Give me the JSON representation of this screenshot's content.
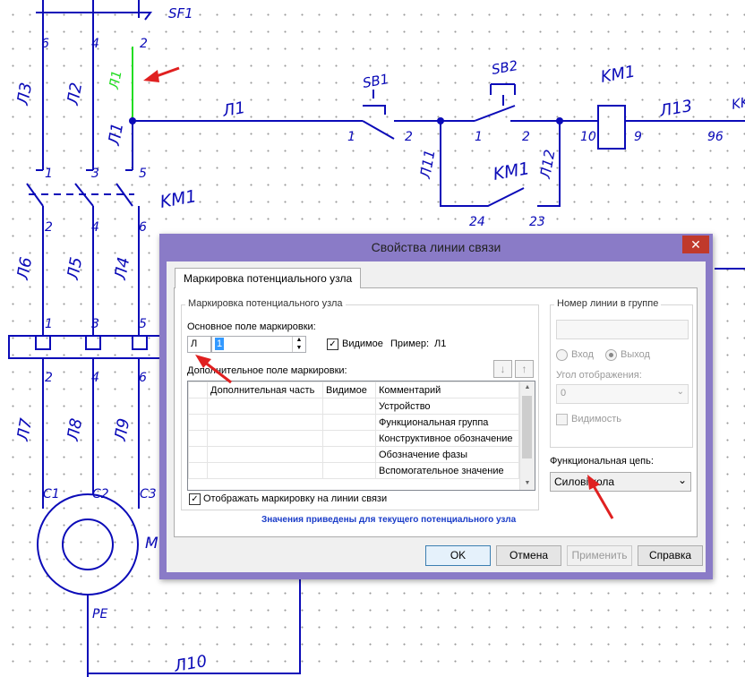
{
  "schematic": {
    "labels": {
      "sf1": "SF1",
      "sb1": "SB1",
      "sb2": "SB2",
      "km1_top": "KM1",
      "km1_mid": "KM1",
      "km1_contact": "KM1",
      "kk": "KK",
      "l3": "Л3",
      "l2": "Л2",
      "l1_green": "Л1",
      "l1_vert": "Л1",
      "l1_wire": "Л1",
      "l11": "Л11",
      "l12": "Л12",
      "l13": "Л13",
      "l6": "Л6",
      "l5": "Л5",
      "l4": "Л4",
      "l7": "Л7",
      "l8": "Л8",
      "l9": "Л9",
      "l10": "Л10",
      "n6_top": "6",
      "n4_top": "4",
      "n2_top": "2",
      "n1_a": "1",
      "n3_a": "3",
      "n5_a": "5",
      "n2_b": "2",
      "n4_b": "4",
      "n6_b": "6",
      "n1_c": "1",
      "n3_c": "3",
      "n5_c": "5",
      "n2_d": "2",
      "n4_d": "4",
      "n6_d": "6",
      "sb1_1": "1",
      "sb1_2": "2",
      "sb2_1": "1",
      "sb2_2": "2",
      "km_10": "10",
      "km_9": "9",
      "kk_96": "96",
      "c24": "24",
      "c23": "23",
      "c1": "C1",
      "c2": "C2",
      "c3": "C3",
      "m": "M",
      "pe": "PE"
    }
  },
  "dialog": {
    "title": "Свойства линии связи",
    "close_glyph": "✕",
    "tab_label": "Маркировка потенциального узла",
    "left_group": {
      "title": "Маркировка потенциального узла",
      "main_field_label": "Основное поле маркировки:",
      "prefix_value": "Л",
      "number_value": "1",
      "visible_label": "Видимое",
      "visible_checked": true,
      "example_label": "Пример:",
      "example_value": "Л1",
      "extra_field_label": "Дополнительное поле маркировки:",
      "table_headers": [
        "",
        "Дополнительная часть",
        "Видимое",
        "Комментарий"
      ],
      "table_rows": [
        {
          "comment": "Устройство"
        },
        {
          "comment": "Функциональная группа"
        },
        {
          "comment": "Конструктивное обозначение"
        },
        {
          "comment": "Обозначение фазы"
        },
        {
          "comment": "Вспомогательное значение"
        }
      ],
      "show_marking_label": "Отображать маркировку на линии связи",
      "show_marking_checked": true,
      "info_text": "Значения приведены для текущего потенциального узла"
    },
    "right_group": {
      "title": "Номер линии в группе",
      "input_value": "",
      "radio_in": "Вход",
      "radio_out": "Выход",
      "angle_label": "Угол отображения:",
      "angle_value": "0",
      "visibility_label": "Видимость",
      "func_chain_label": "Функциональная цепь:",
      "func_chain_value": "Силові кола"
    },
    "buttons": {
      "ok": "OK",
      "cancel": "Отмена",
      "apply": "Применить",
      "help": "Справка"
    }
  },
  "colors": {
    "schematic_blue": "#0b0bb8",
    "highlight_green": "#22dd22",
    "arrow_red": "#e02020",
    "dialog_frame": "#8a7bc7",
    "info_blue": "#1a3cc8"
  }
}
